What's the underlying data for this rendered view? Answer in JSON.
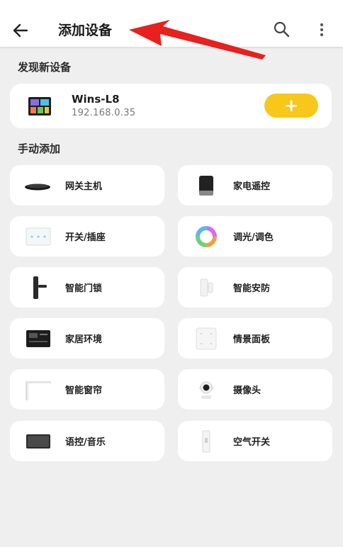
{
  "header": {
    "title": "添加设备",
    "back_icon": "arrow-left-icon",
    "search_icon": "search-icon",
    "more_icon": "more-vertical-icon"
  },
  "discovered": {
    "section_title": "发现新设备",
    "device": {
      "name": "Wins-L8",
      "ip": "192.168.0.35",
      "add_label": "+"
    }
  },
  "manual": {
    "section_title": "手动添加",
    "items": [
      {
        "label": "网关主机",
        "icon": "gateway-icon"
      },
      {
        "label": "家电遥控",
        "icon": "appliance-remote-icon"
      },
      {
        "label": "开关/插座",
        "icon": "switch-panel-icon"
      },
      {
        "label": "调光/调色",
        "icon": "color-ring-icon"
      },
      {
        "label": "智能门锁",
        "icon": "door-lock-icon"
      },
      {
        "label": "智能安防",
        "icon": "security-sensor-icon"
      },
      {
        "label": "家居环境",
        "icon": "thermostat-panel-icon"
      },
      {
        "label": "情景面板",
        "icon": "scene-panel-icon"
      },
      {
        "label": "智能窗帘",
        "icon": "curtain-icon"
      },
      {
        "label": "摄像头",
        "icon": "camera-icon"
      },
      {
        "label": "语控/音乐",
        "icon": "voice-panel-icon"
      },
      {
        "label": "空气开关",
        "icon": "air-switch-icon"
      }
    ]
  },
  "colors": {
    "accent": "#f7c819",
    "annotation": "#e8201e",
    "background": "#efefef"
  }
}
